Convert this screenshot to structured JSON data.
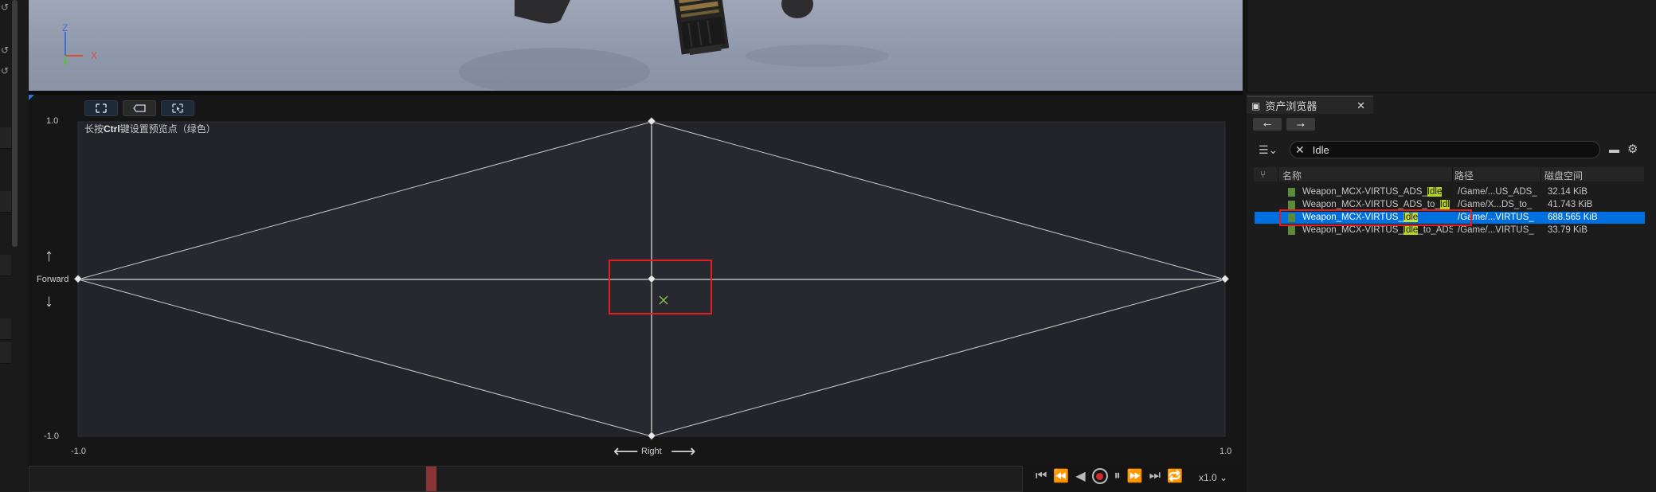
{
  "viewport": {
    "axis_z": "Z",
    "axis_x": "X",
    "axis_y": "Y",
    "colors": {
      "z": "#3b6fd8",
      "x": "#d84a3b",
      "y": "#5bbf3b"
    }
  },
  "blend_space": {
    "hint_prefix": "长按",
    "hint_key": "Ctrl",
    "hint_suffix": "键设置预览点（绿色）",
    "y_max": "1.0",
    "y_min": "-1.0",
    "x_min": "-1.0",
    "x_max": "1.0",
    "y_axis_name": "Forward",
    "x_axis_name": "Right",
    "preview_color": "#8bc34a",
    "highlight_color": "#e02020"
  },
  "timeline": {
    "speed_label": "x1.0"
  },
  "asset_browser": {
    "tab_title": "资产浏览器",
    "search_value": "Idle",
    "columns": {
      "name": "名称",
      "path": "路径",
      "disk": "磁盘空间"
    },
    "rows": [
      {
        "name_pre": "Weapon_MCX-VIRTUS_ADS_",
        "name_hl": "Idle",
        "name_post": "",
        "path": "/Game/...US_ADS_",
        "size": "32.14 KiB"
      },
      {
        "name_pre": "Weapon_MCX-VIRTUS_ADS_to_",
        "name_hl": "Idl",
        "name_post": "",
        "path": "/Game/X...DS_to_",
        "size": "41.743 KiB"
      },
      {
        "name_pre": "Weapon_MCX-VIRTUS_",
        "name_hl": "Idle",
        "name_post": "",
        "path": "/Game/...VIRTUS_",
        "size": "688.565 KiB"
      },
      {
        "name_pre": "Weapon_MCX-VIRTUS_",
        "name_hl": "Idle",
        "name_post": "_to_ADS",
        "path": "/Game/...VIRTUS_",
        "size": "33.79 KiB"
      }
    ]
  }
}
